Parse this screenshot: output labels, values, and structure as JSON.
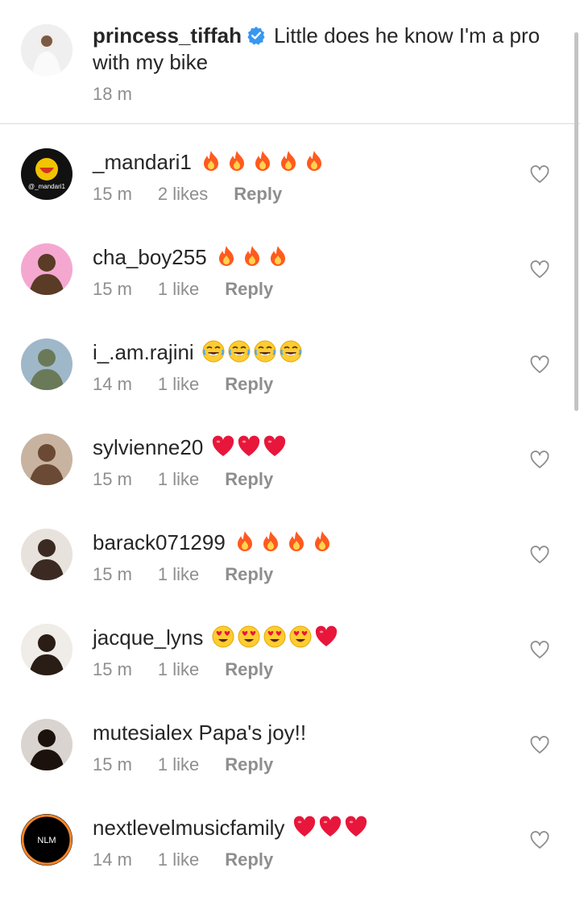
{
  "caption": {
    "username": "princess_tiffah",
    "text": "Little does he know I'm a pro with my bike",
    "time": "18 m",
    "verified_color": "#3897f0"
  },
  "comments": [
    {
      "username": "_mandari1",
      "text": "",
      "emojis": [
        "fire",
        "fire",
        "fire",
        "fire",
        "fire"
      ],
      "time": "15 m",
      "likes": "2 likes",
      "reply": "Reply",
      "avatar_colors": [
        "#111111",
        "#f2c300"
      ],
      "avatar_text": "@_mandari1"
    },
    {
      "username": "cha_boy255",
      "text": "",
      "emojis": [
        "fire",
        "fire",
        "fire"
      ],
      "time": "15 m",
      "likes": "1 like",
      "reply": "Reply",
      "avatar_colors": [
        "#f4a8d0",
        "#5a3b26"
      ]
    },
    {
      "username": "i_.am.rajini",
      "text": "",
      "emojis": [
        "joy",
        "joy",
        "joy",
        "joy"
      ],
      "time": "14 m",
      "likes": "1 like",
      "reply": "Reply",
      "avatar_colors": [
        "#9fb8c9",
        "#6a7a58"
      ]
    },
    {
      "username": "sylvienne20",
      "text": "",
      "emojis": [
        "heart",
        "heart",
        "heart"
      ],
      "time": "15 m",
      "likes": "1 like",
      "reply": "Reply",
      "avatar_colors": [
        "#c7b3a0",
        "#6b4a35"
      ]
    },
    {
      "username": "barack071299",
      "text": "",
      "emojis": [
        "fire",
        "fire",
        "fire",
        "fire"
      ],
      "time": "15 m",
      "likes": "1 like",
      "reply": "Reply",
      "avatar_colors": [
        "#e7e2dc",
        "#3a2a22"
      ]
    },
    {
      "username": "jacque_lyns",
      "text": "",
      "emojis": [
        "heart-eyes",
        "heart-eyes",
        "heart-eyes",
        "heart-eyes",
        "heart"
      ],
      "time": "15 m",
      "likes": "1 like",
      "reply": "Reply",
      "avatar_colors": [
        "#f0ece8",
        "#2a1d16"
      ]
    },
    {
      "username": "mutesialex",
      "text": "Papa's joy!!",
      "emojis": [],
      "time": "15 m",
      "likes": "1 like",
      "reply": "Reply",
      "avatar_colors": [
        "#d9d4cf",
        "#1c120d"
      ]
    },
    {
      "username": "nextlevelmusicfamily",
      "text": "",
      "emojis": [
        "heart",
        "heart",
        "heart"
      ],
      "time": "14 m",
      "likes": "1 like",
      "reply": "Reply",
      "avatar_colors": [
        "#000000",
        "#ffffff"
      ],
      "avatar_text": "NLM",
      "story_ring": true
    }
  ],
  "icons": {
    "like": "heart-outline-icon",
    "verified": "verified-badge-icon"
  }
}
